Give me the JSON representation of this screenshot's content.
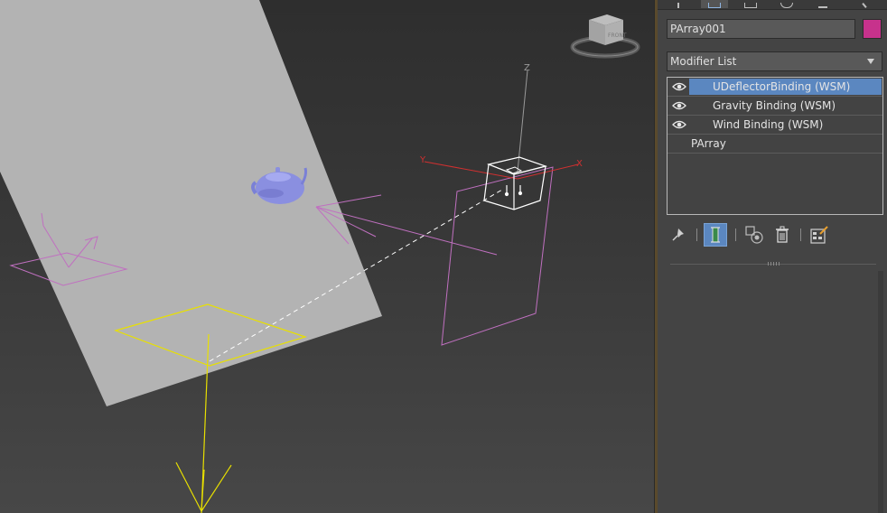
{
  "command_panel": {
    "tabs": [
      "create-tab",
      "modify-tab",
      "hierarchy-tab",
      "motion-tab",
      "display-tab",
      "utilities-tab"
    ],
    "active_tab": "modify-tab"
  },
  "object": {
    "name": "PArray001",
    "color": "#c7328c"
  },
  "modifier_list": {
    "label": "Modifier List"
  },
  "modifier_stack": {
    "items": [
      {
        "label": "UDeflectorBinding (WSM)",
        "selected": true,
        "eye": true
      },
      {
        "label": "Gravity Binding (WSM)",
        "selected": false,
        "eye": true
      },
      {
        "label": "Wind Binding (WSM)",
        "selected": false,
        "eye": true
      },
      {
        "label": "PArray",
        "selected": false,
        "eye": false
      }
    ]
  },
  "stack_toolbar": {
    "buttons": [
      "pin-stack",
      "show-end-result",
      "make-unique",
      "remove-modifier",
      "configure-modifier-sets"
    ],
    "active": "show-end-result"
  },
  "viewport": {
    "gizmo_axis_labels": {
      "x": "X",
      "y": "Y",
      "z": "Z"
    },
    "viewcube_face": "FRONT",
    "colors": {
      "deflector_plane": "#b3b3b3",
      "teapot": "#8a8fe0",
      "wind_gizmo": "#c070c0",
      "emitter": "#e8e000",
      "gizmo_x": "#d03030"
    }
  }
}
